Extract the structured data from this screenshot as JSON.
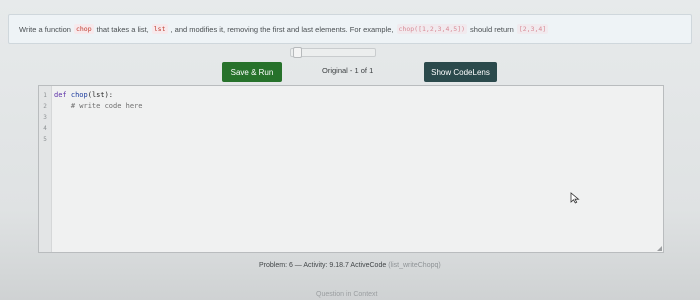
{
  "prompt": {
    "text_1": "Write a function",
    "code_1": "chop",
    "text_2": "that takes a list,",
    "code_2": "lst",
    "text_3": ", and modifies it, removing the first and last elements. For example,",
    "code_3": "chop([1,2,3,4,5])",
    "text_4": "should return",
    "code_4": "[2,3,4]"
  },
  "toolbar": {
    "save_label": "Save & Run",
    "history_label": "Original - 1 of 1",
    "codelens_label": "Show CodeLens"
  },
  "editor": {
    "lines": [
      {
        "num": "1",
        "kw": "def",
        "fn": "chop",
        "rest": "(lst):"
      },
      {
        "num": "2",
        "comment": "    # write code here"
      },
      {
        "num": "3"
      },
      {
        "num": "4"
      },
      {
        "num": "5"
      }
    ]
  },
  "activity": {
    "label": "Problem: 6 — Activity: 9.18.7 ActiveCode",
    "id": "(list_writeChopq)"
  },
  "footer": {
    "question_in_context": "Question in Context"
  },
  "colors": {
    "save_button": "#27722b",
    "codelens_button": "#2b4a4c",
    "prompt_background": "#eef3f6"
  },
  "icons": {
    "cursor": "mouse-pointer-icon"
  }
}
